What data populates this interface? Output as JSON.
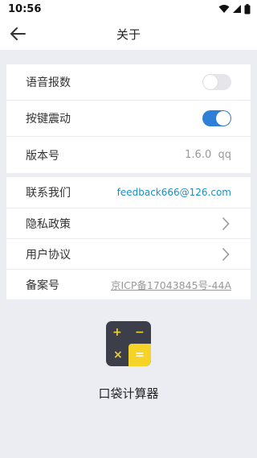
{
  "status_bar": {
    "time": "10:56",
    "icons": [
      "wifi-icon",
      "signal-icon",
      "battery-icon"
    ]
  },
  "app_bar": {
    "title": "关于",
    "back_icon": "arrow-left-icon"
  },
  "settings": {
    "voice": {
      "label": "语音报数",
      "enabled": false
    },
    "vibration": {
      "label": "按键震动",
      "enabled": true
    },
    "version": {
      "label": "版本号",
      "value": "1.6.0  qq"
    }
  },
  "info": {
    "contact": {
      "label": "联系我们",
      "value": "feedback666@126.com"
    },
    "privacy": {
      "label": "隐私政策"
    },
    "agreement": {
      "label": "用户协议"
    },
    "record": {
      "label": "备案号",
      "value": "京ICP备17043845号-44A"
    }
  },
  "app": {
    "name": "口袋计算器",
    "icon_keys": [
      "+",
      "−",
      "×",
      "="
    ]
  },
  "colors": {
    "accent": "#2f7fd8",
    "link": "#1a8fc7",
    "icon_bg": "#3c3f4a",
    "icon_yellow": "#f5d327",
    "page_bg": "#ececf3"
  }
}
